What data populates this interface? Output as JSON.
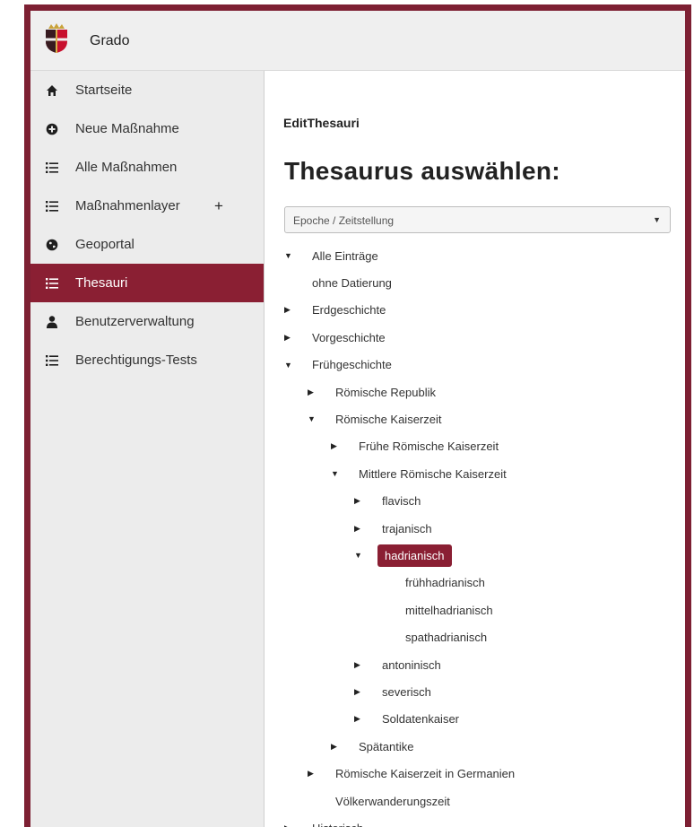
{
  "app": {
    "title": "Grado"
  },
  "sidebar": {
    "items": [
      {
        "id": "startseite",
        "label": "Startseite",
        "icon": "home-icon"
      },
      {
        "id": "neue-massnahme",
        "label": "Neue Maßnahme",
        "icon": "plus-circle-icon"
      },
      {
        "id": "alle-massnahmen",
        "label": "Alle Maßnahmen",
        "icon": "list-icon"
      },
      {
        "id": "massnahmenlayer",
        "label": "Maßnahmenlayer",
        "icon": "list-icon",
        "extra": "+"
      },
      {
        "id": "geoportal",
        "label": "Geoportal",
        "icon": "globe-icon"
      },
      {
        "id": "thesauri",
        "label": "Thesauri",
        "icon": "list-icon",
        "active": true
      },
      {
        "id": "benutzerverwaltung",
        "label": "Benutzerverwaltung",
        "icon": "user-icon"
      },
      {
        "id": "berechtigungs-tests",
        "label": "Berechtigungs-Tests",
        "icon": "list-icon"
      }
    ]
  },
  "main": {
    "breadcrumb": "EditThesauri",
    "heading": "Thesaurus auswählen:",
    "select": {
      "value": "Epoche / Zeitstellung"
    },
    "tree": [
      {
        "label": "Alle Einträge",
        "depth": 0,
        "toggle": "expanded"
      },
      {
        "label": "ohne Datierung",
        "depth": 0,
        "toggle": "none"
      },
      {
        "label": "Erdgeschichte",
        "depth": 0,
        "toggle": "collapsed"
      },
      {
        "label": "Vorgeschichte",
        "depth": 0,
        "toggle": "collapsed"
      },
      {
        "label": "Frühgeschichte",
        "depth": 0,
        "toggle": "expanded"
      },
      {
        "label": "Römische Republik",
        "depth": 1,
        "toggle": "collapsed"
      },
      {
        "label": "Römische Kaiserzeit",
        "depth": 1,
        "toggle": "expanded"
      },
      {
        "label": "Frühe Römische Kaiserzeit",
        "depth": 2,
        "toggle": "collapsed"
      },
      {
        "label": "Mittlere Römische Kaiserzeit",
        "depth": 2,
        "toggle": "expanded"
      },
      {
        "label": "flavisch",
        "depth": 3,
        "toggle": "collapsed"
      },
      {
        "label": "trajanisch",
        "depth": 3,
        "toggle": "collapsed"
      },
      {
        "label": "hadrianisch",
        "depth": 3,
        "toggle": "expanded",
        "selected": true
      },
      {
        "label": "frühhadrianisch",
        "depth": 4,
        "toggle": "none"
      },
      {
        "label": "mittelhadrianisch",
        "depth": 4,
        "toggle": "none"
      },
      {
        "label": "spathadrianisch",
        "depth": 4,
        "toggle": "none"
      },
      {
        "label": "antoninisch",
        "depth": 3,
        "toggle": "collapsed"
      },
      {
        "label": "severisch",
        "depth": 3,
        "toggle": "collapsed"
      },
      {
        "label": "Soldatenkaiser",
        "depth": 3,
        "toggle": "collapsed"
      },
      {
        "label": "Spätantike",
        "depth": 2,
        "toggle": "collapsed"
      },
      {
        "label": "Römische Kaiserzeit in Germanien",
        "depth": 1,
        "toggle": "collapsed"
      },
      {
        "label": "Völkerwanderungszeit",
        "depth": 1,
        "toggle": "none"
      },
      {
        "label": "Historisch",
        "depth": 0,
        "toggle": "collapsed"
      }
    ]
  },
  "colors": {
    "accent": "#8a1f33",
    "frame": "#7d2033",
    "sidebar_bg": "#ececec",
    "topbar_bg": "#efefef"
  }
}
